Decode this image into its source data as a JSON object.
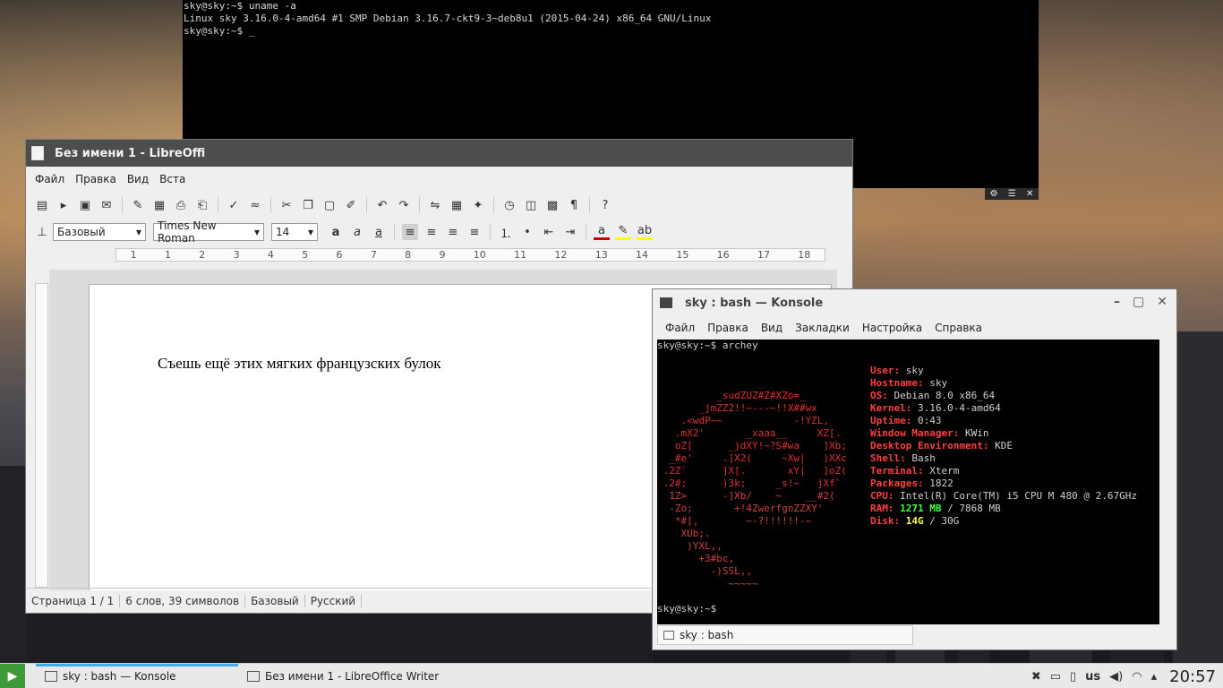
{
  "top_terminal": {
    "lines": [
      "sky@sky:~$ uname -a",
      "Linux sky 3.16.0-4-amd64 #1 SMP Debian 3.16.7-ckt9-3~deb8u1 (2015-04-24) x86_64 GNU/Linux",
      "sky@sky:~$ _"
    ]
  },
  "writer": {
    "title": "Без имени 1 - LibreOffi",
    "menu": [
      "Файл",
      "Правка",
      "Вид",
      "Вста"
    ],
    "style": "Базовый",
    "font": "Times New Roman",
    "size": "14",
    "ruler_ticks": [
      "1",
      "1",
      "2",
      "3",
      "4",
      "5",
      "6",
      "7",
      "8",
      "9",
      "10",
      "11",
      "12",
      "13",
      "14",
      "15",
      "16",
      "17",
      "18"
    ],
    "text": "Съешь ещё этих мягких французских булок",
    "status": {
      "page": "Страница 1 / 1",
      "words": "6 слов, 39 символов",
      "style": "Базовый",
      "lang": "Русский"
    }
  },
  "konsole": {
    "title": "sky : bash — Konsole",
    "menu": [
      "Файл",
      "Правка",
      "Вид",
      "Закладки",
      "Настройка",
      "Справка"
    ],
    "prompt1": "sky@sky:~$ archey",
    "prompt2": "sky@sky:~$",
    "tab": "sky : bash",
    "art": [
      "          _sudZUZ#Z#XZo=_",
      "       _jmZZ2!!~---~!!X##wx",
      "    .<wdP~~            -!YZL,",
      "   .mX2'       _xaaa__     XZ[.",
      "   oZ[      _jdXY!~?S#wa    ]Xb;",
      "  _#e'     .]X2(     ~Xw|   )XXc",
      " .2Z`      ]X[.       xY|   ]oZ(",
      " .2#;      )3k;     _s!~   jXf`",
      "  1Z>      -]Xb/    ~    __#2(",
      "  -Zo;       +!4ZwerfgnZZXY'",
      "   *#[,        ~-?!!!!!!-~",
      "    XUb;.",
      "     )YXL,,",
      "       +3#bc,",
      "         -)SSL,,",
      "            ~~~~~"
    ],
    "info": [
      {
        "k": "User:",
        "v": " sky"
      },
      {
        "k": "Hostname:",
        "v": " sky"
      },
      {
        "k": "OS:",
        "v": " Debian 8.0 x86_64"
      },
      {
        "k": "Kernel:",
        "v": " 3.16.0-4-amd64"
      },
      {
        "k": "Uptime:",
        "v": " 0:43"
      },
      {
        "k": "Window Manager:",
        "v": " KWin"
      },
      {
        "k": "Desktop Environment:",
        "v": " KDE"
      },
      {
        "k": "Shell:",
        "v": " Bash"
      },
      {
        "k": "Terminal:",
        "v": " Xterm"
      },
      {
        "k": "Packages:",
        "v": " 1822"
      },
      {
        "k": "CPU:",
        "v": " Intel(R) Core(TM) i5 CPU M 480 @ 2.67GHz"
      }
    ],
    "ram_label": "RAM:",
    "ram_used": "1271 MB",
    "ram_total": " / 7868 MB",
    "disk_label": "Disk:",
    "disk_used": "14G",
    "disk_total": " / 30G"
  },
  "taskbar": {
    "tasks": [
      "sky : bash — Konsole",
      "Без имени 1 - LibreOffice Writer"
    ],
    "keyboard": "us",
    "clock": "20:57"
  }
}
